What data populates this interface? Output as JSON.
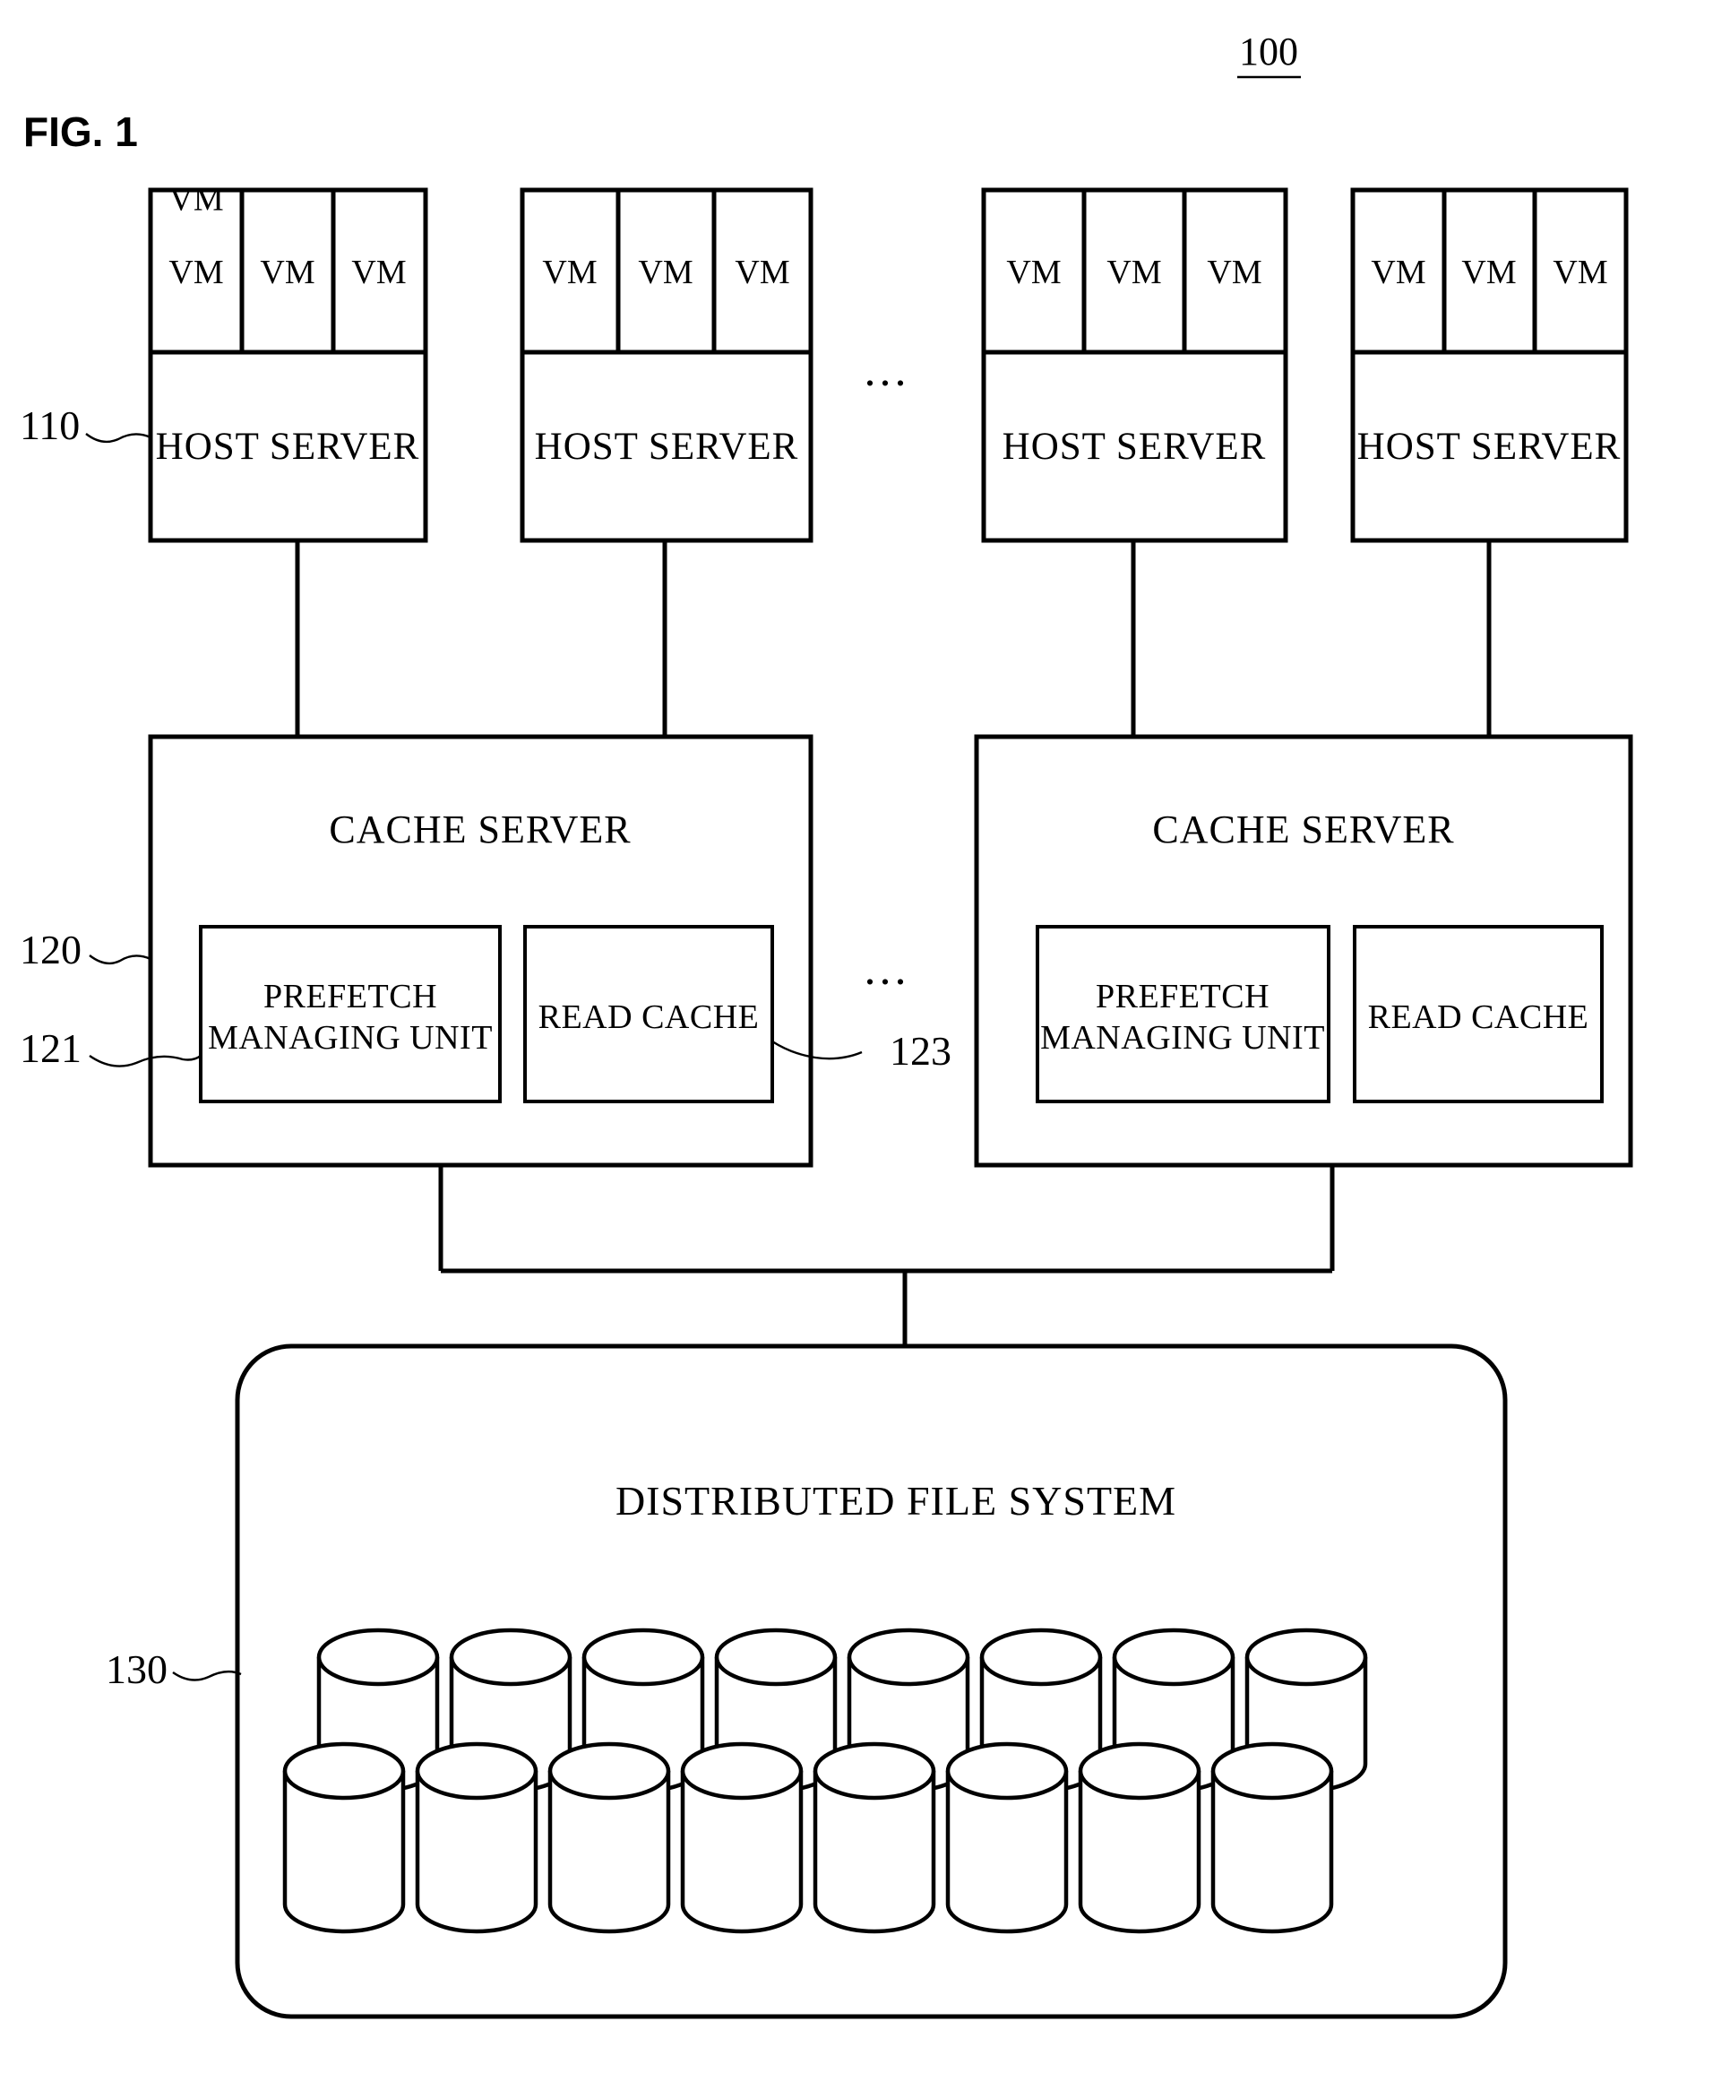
{
  "figure": {
    "label": "FIG. 1",
    "system_ref": "100",
    "ellipsis": "..."
  },
  "refs": {
    "host_tier": "110",
    "cache_tier": "120",
    "prefetch_unit": "121",
    "read_cache": "123",
    "file_system": "130"
  },
  "host_tier": {
    "vm_label": "VM",
    "server_label": "HOST SERVER",
    "servers": [
      {
        "vms": [
          "VM",
          "VM",
          "VM"
        ],
        "label": "HOST SERVER"
      },
      {
        "vms": [
          "VM",
          "VM",
          "VM"
        ],
        "label": "HOST SERVER"
      },
      {
        "vms": [
          "VM",
          "VM",
          "VM"
        ],
        "label": "HOST SERVER"
      },
      {
        "vms": [
          "VM",
          "VM",
          "VM"
        ],
        "label": "HOST SERVER"
      }
    ],
    "ellipsis": "..."
  },
  "cache_tier": {
    "ellipsis": "...",
    "servers": [
      {
        "title": "CACHE SERVER",
        "modules": [
          {
            "line1": "PREFETCH",
            "line2": "MANAGING UNIT"
          },
          {
            "line1": "READ CACHE",
            "line2": ""
          }
        ]
      },
      {
        "title": "CACHE SERVER",
        "modules": [
          {
            "line1": "PREFETCH",
            "line2": "MANAGING UNIT"
          },
          {
            "line1": "READ CACHE",
            "line2": ""
          }
        ]
      }
    ]
  },
  "storage_tier": {
    "title": "DISTRIBUTED FILE SYSTEM",
    "back_row_disk_count": 8,
    "front_row_disk_count": 8
  },
  "colors": {
    "stroke": "#000000",
    "fill": "#ffffff",
    "background": "#ffffff"
  }
}
